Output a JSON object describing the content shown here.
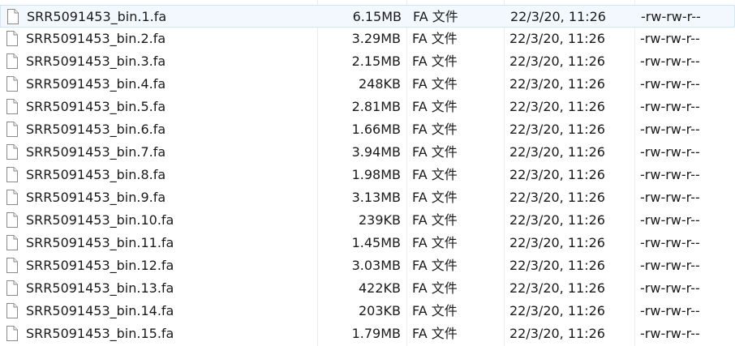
{
  "files": [
    {
      "name": "SRR5091453_bin.1.fa",
      "size": "6.15MB",
      "type": "FA 文件",
      "modified": "22/3/20, 11:26",
      "permissions": "-rw-rw-r--",
      "selected": true
    },
    {
      "name": "SRR5091453_bin.2.fa",
      "size": "3.29MB",
      "type": "FA 文件",
      "modified": "22/3/20, 11:26",
      "permissions": "-rw-rw-r--"
    },
    {
      "name": "SRR5091453_bin.3.fa",
      "size": "2.15MB",
      "type": "FA 文件",
      "modified": "22/3/20, 11:26",
      "permissions": "-rw-rw-r--"
    },
    {
      "name": "SRR5091453_bin.4.fa",
      "size": "248KB",
      "type": "FA 文件",
      "modified": "22/3/20, 11:26",
      "permissions": "-rw-rw-r--"
    },
    {
      "name": "SRR5091453_bin.5.fa",
      "size": "2.81MB",
      "type": "FA 文件",
      "modified": "22/3/20, 11:26",
      "permissions": "-rw-rw-r--"
    },
    {
      "name": "SRR5091453_bin.6.fa",
      "size": "1.66MB",
      "type": "FA 文件",
      "modified": "22/3/20, 11:26",
      "permissions": "-rw-rw-r--"
    },
    {
      "name": "SRR5091453_bin.7.fa",
      "size": "3.94MB",
      "type": "FA 文件",
      "modified": "22/3/20, 11:26",
      "permissions": "-rw-rw-r--"
    },
    {
      "name": "SRR5091453_bin.8.fa",
      "size": "1.98MB",
      "type": "FA 文件",
      "modified": "22/3/20, 11:26",
      "permissions": "-rw-rw-r--"
    },
    {
      "name": "SRR5091453_bin.9.fa",
      "size": "3.13MB",
      "type": "FA 文件",
      "modified": "22/3/20, 11:26",
      "permissions": "-rw-rw-r--"
    },
    {
      "name": "SRR5091453_bin.10.fa",
      "size": "239KB",
      "type": "FA 文件",
      "modified": "22/3/20, 11:26",
      "permissions": "-rw-rw-r--"
    },
    {
      "name": "SRR5091453_bin.11.fa",
      "size": "1.45MB",
      "type": "FA 文件",
      "modified": "22/3/20, 11:26",
      "permissions": "-rw-rw-r--"
    },
    {
      "name": "SRR5091453_bin.12.fa",
      "size": "3.03MB",
      "type": "FA 文件",
      "modified": "22/3/20, 11:26",
      "permissions": "-rw-rw-r--"
    },
    {
      "name": "SRR5091453_bin.13.fa",
      "size": "422KB",
      "type": "FA 文件",
      "modified": "22/3/20, 11:26",
      "permissions": "-rw-rw-r--"
    },
    {
      "name": "SRR5091453_bin.14.fa",
      "size": "203KB",
      "type": "FA 文件",
      "modified": "22/3/20, 11:26",
      "permissions": "-rw-rw-r--"
    },
    {
      "name": "SRR5091453_bin.15.fa",
      "size": "1.79MB",
      "type": "FA 文件",
      "modified": "22/3/20, 11:26",
      "permissions": "-rw-rw-r--"
    }
  ],
  "file_icon": "document-icon",
  "colors": {
    "selection_background": "#f2f8fe",
    "selection_border": "#cde8ff",
    "column_divider": "#ececec",
    "text": "#1a1a1a"
  }
}
